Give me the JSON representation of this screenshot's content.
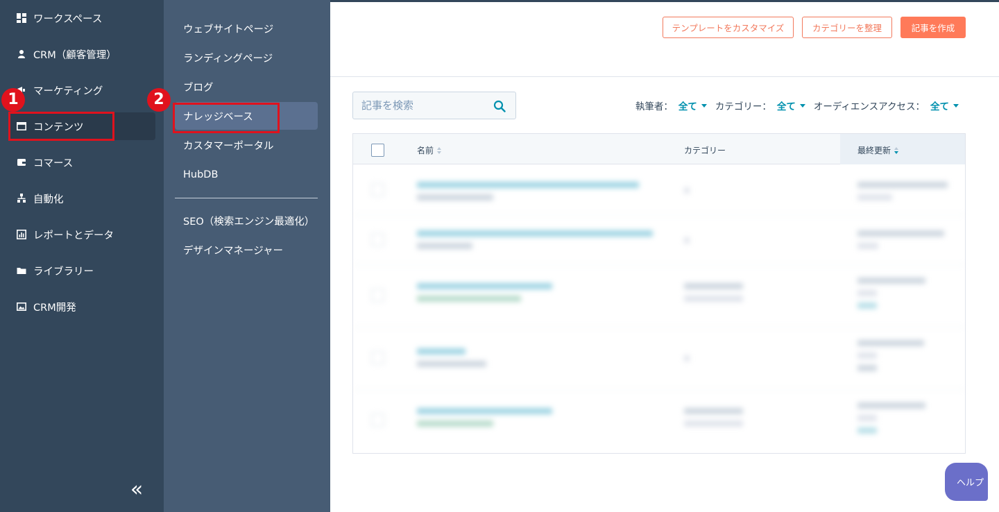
{
  "primary_nav": {
    "items": [
      {
        "label": "ワークスペース",
        "icon": "grid-icon"
      },
      {
        "label": "CRM（顧客管理）",
        "icon": "person-icon"
      },
      {
        "label": "マーケティング",
        "icon": "megaphone-icon"
      },
      {
        "label": "コンテンツ",
        "icon": "window-icon"
      },
      {
        "label": "コマース",
        "icon": "wallet-icon"
      },
      {
        "label": "自動化",
        "icon": "workflow-icon"
      },
      {
        "label": "レポートとデータ",
        "icon": "bar-chart-icon"
      },
      {
        "label": "ライブラリー",
        "icon": "folder-icon"
      },
      {
        "label": "CRM開発",
        "icon": "image-icon"
      }
    ],
    "collapse_label": "«"
  },
  "secondary_nav": {
    "items": [
      {
        "label": "ウェブサイトページ"
      },
      {
        "label": "ランディングページ"
      },
      {
        "label": "ブログ"
      },
      {
        "label": "ナレッジベース"
      },
      {
        "label": "カスタマーポータル"
      },
      {
        "label": "HubDB"
      },
      {
        "label": "SEO（検索エンジン最適化）"
      },
      {
        "label": "デザインマネージャー"
      }
    ]
  },
  "annotations": {
    "step1": "1",
    "step2": "2"
  },
  "header": {
    "customize_template_label": "テンプレートをカスタマイズ",
    "organize_categories_label": "カテゴリーを整理",
    "create_article_label": "記事を作成"
  },
  "search": {
    "placeholder": "記事を検索"
  },
  "filters": {
    "author_label": "執筆者：",
    "author_value": "全て",
    "category_label": "カテゴリー：",
    "category_value": "全て",
    "audience_label": "オーディエンスアクセス：",
    "audience_value": "全て"
  },
  "table": {
    "headers": {
      "name": "名前",
      "category": "カテゴリー",
      "last_updated": "最終更新"
    }
  },
  "help": {
    "label": "ヘルプ"
  },
  "colors": {
    "sidebar_primary": "#33475b",
    "sidebar_secondary": "#475c74",
    "accent_orange": "#ff7a59",
    "link_teal": "#0091ae",
    "annotation_red": "#e0121d"
  }
}
